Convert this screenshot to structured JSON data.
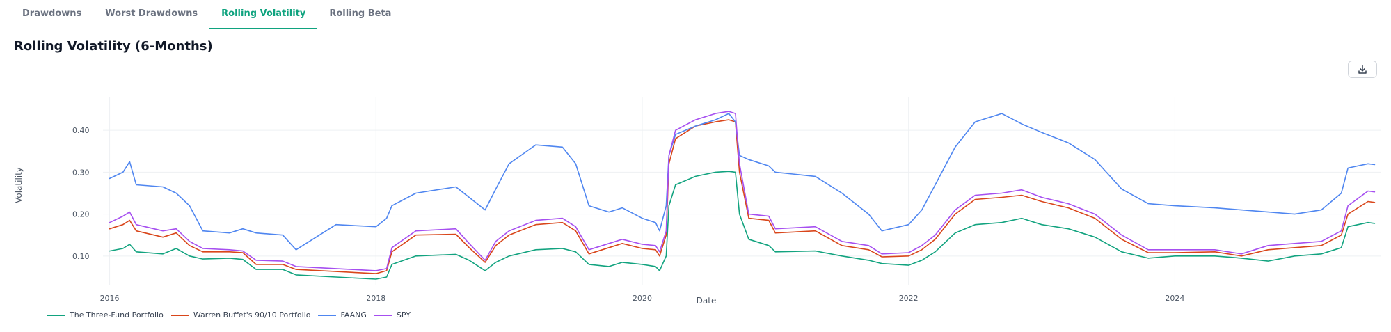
{
  "tabs": [
    {
      "label": "Drawdowns",
      "active": false
    },
    {
      "label": "Worst Drawdowns",
      "active": false
    },
    {
      "label": "Rolling Volatility",
      "active": true
    },
    {
      "label": "Rolling Beta",
      "active": false
    }
  ],
  "chart_title": "Rolling Volatility (6-Months)",
  "download_icon": "download-icon",
  "chart_data": {
    "type": "line",
    "title": "Rolling Volatility (6-Months)",
    "xlabel": "Date",
    "ylabel": "Volatility",
    "x_ticks": [
      "2016",
      "2018",
      "2020",
      "2022",
      "2024"
    ],
    "y_ticks": [
      "0.10",
      "0.20",
      "0.30",
      "0.40"
    ],
    "xlim": [
      2015.95,
      2025.55
    ],
    "ylim": [
      0.03,
      0.47
    ],
    "grid": true,
    "legend_position": "bottom-left",
    "series": [
      {
        "name": "The Three-Fund Portfolio",
        "color": "#12a37f",
        "points": [
          [
            2016.0,
            0.112
          ],
          [
            2016.1,
            0.118
          ],
          [
            2016.15,
            0.128
          ],
          [
            2016.2,
            0.11
          ],
          [
            2016.4,
            0.105
          ],
          [
            2016.5,
            0.118
          ],
          [
            2016.6,
            0.1
          ],
          [
            2016.7,
            0.093
          ],
          [
            2016.9,
            0.095
          ],
          [
            2017.0,
            0.092
          ],
          [
            2017.1,
            0.068
          ],
          [
            2017.3,
            0.068
          ],
          [
            2017.4,
            0.055
          ],
          [
            2017.7,
            0.05
          ],
          [
            2018.0,
            0.045
          ],
          [
            2018.08,
            0.05
          ],
          [
            2018.12,
            0.08
          ],
          [
            2018.3,
            0.1
          ],
          [
            2018.6,
            0.104
          ],
          [
            2018.7,
            0.09
          ],
          [
            2018.82,
            0.065
          ],
          [
            2018.9,
            0.085
          ],
          [
            2019.0,
            0.1
          ],
          [
            2019.2,
            0.115
          ],
          [
            2019.4,
            0.118
          ],
          [
            2019.5,
            0.11
          ],
          [
            2019.6,
            0.08
          ],
          [
            2019.75,
            0.075
          ],
          [
            2019.85,
            0.085
          ],
          [
            2020.0,
            0.08
          ],
          [
            2020.1,
            0.075
          ],
          [
            2020.13,
            0.065
          ],
          [
            2020.18,
            0.1
          ],
          [
            2020.2,
            0.22
          ],
          [
            2020.25,
            0.27
          ],
          [
            2020.4,
            0.29
          ],
          [
            2020.55,
            0.3
          ],
          [
            2020.65,
            0.302
          ],
          [
            2020.7,
            0.3
          ],
          [
            2020.73,
            0.2
          ],
          [
            2020.8,
            0.14
          ],
          [
            2020.95,
            0.125
          ],
          [
            2021.0,
            0.11
          ],
          [
            2021.3,
            0.112
          ],
          [
            2021.5,
            0.1
          ],
          [
            2021.7,
            0.09
          ],
          [
            2021.8,
            0.082
          ],
          [
            2022.0,
            0.078
          ],
          [
            2022.1,
            0.09
          ],
          [
            2022.2,
            0.11
          ],
          [
            2022.35,
            0.155
          ],
          [
            2022.5,
            0.175
          ],
          [
            2022.7,
            0.18
          ],
          [
            2022.85,
            0.19
          ],
          [
            2023.0,
            0.175
          ],
          [
            2023.2,
            0.165
          ],
          [
            2023.4,
            0.145
          ],
          [
            2023.6,
            0.11
          ],
          [
            2023.8,
            0.095
          ],
          [
            2024.0,
            0.1
          ],
          [
            2024.3,
            0.1
          ],
          [
            2024.5,
            0.095
          ],
          [
            2024.7,
            0.088
          ],
          [
            2024.9,
            0.1
          ],
          [
            2025.1,
            0.105
          ],
          [
            2025.25,
            0.12
          ],
          [
            2025.3,
            0.17
          ],
          [
            2025.45,
            0.18
          ],
          [
            2025.5,
            0.178
          ]
        ]
      },
      {
        "name": "Warren Buffet's 90/10 Portfolio",
        "color": "#d9461b",
        "points": [
          [
            2016.0,
            0.165
          ],
          [
            2016.1,
            0.175
          ],
          [
            2016.15,
            0.185
          ],
          [
            2016.2,
            0.16
          ],
          [
            2016.4,
            0.145
          ],
          [
            2016.5,
            0.155
          ],
          [
            2016.6,
            0.125
          ],
          [
            2016.7,
            0.11
          ],
          [
            2016.9,
            0.11
          ],
          [
            2017.0,
            0.108
          ],
          [
            2017.1,
            0.08
          ],
          [
            2017.3,
            0.08
          ],
          [
            2017.4,
            0.068
          ],
          [
            2017.7,
            0.063
          ],
          [
            2018.0,
            0.058
          ],
          [
            2018.08,
            0.065
          ],
          [
            2018.12,
            0.11
          ],
          [
            2018.3,
            0.15
          ],
          [
            2018.6,
            0.152
          ],
          [
            2018.7,
            0.12
          ],
          [
            2018.82,
            0.085
          ],
          [
            2018.9,
            0.125
          ],
          [
            2019.0,
            0.15
          ],
          [
            2019.2,
            0.175
          ],
          [
            2019.4,
            0.18
          ],
          [
            2019.5,
            0.16
          ],
          [
            2019.6,
            0.105
          ],
          [
            2019.75,
            0.12
          ],
          [
            2019.85,
            0.13
          ],
          [
            2020.0,
            0.118
          ],
          [
            2020.1,
            0.115
          ],
          [
            2020.13,
            0.1
          ],
          [
            2020.18,
            0.15
          ],
          [
            2020.2,
            0.32
          ],
          [
            2020.25,
            0.38
          ],
          [
            2020.4,
            0.41
          ],
          [
            2020.55,
            0.42
          ],
          [
            2020.65,
            0.425
          ],
          [
            2020.7,
            0.42
          ],
          [
            2020.73,
            0.3
          ],
          [
            2020.8,
            0.19
          ],
          [
            2020.95,
            0.185
          ],
          [
            2021.0,
            0.155
          ],
          [
            2021.3,
            0.16
          ],
          [
            2021.5,
            0.125
          ],
          [
            2021.7,
            0.115
          ],
          [
            2021.8,
            0.098
          ],
          [
            2022.0,
            0.1
          ],
          [
            2022.1,
            0.115
          ],
          [
            2022.2,
            0.14
          ],
          [
            2022.35,
            0.2
          ],
          [
            2022.5,
            0.235
          ],
          [
            2022.7,
            0.24
          ],
          [
            2022.85,
            0.245
          ],
          [
            2023.0,
            0.23
          ],
          [
            2023.2,
            0.215
          ],
          [
            2023.4,
            0.19
          ],
          [
            2023.6,
            0.14
          ],
          [
            2023.8,
            0.108
          ],
          [
            2024.0,
            0.108
          ],
          [
            2024.3,
            0.11
          ],
          [
            2024.5,
            0.1
          ],
          [
            2024.7,
            0.115
          ],
          [
            2024.9,
            0.12
          ],
          [
            2025.1,
            0.125
          ],
          [
            2025.25,
            0.15
          ],
          [
            2025.3,
            0.2
          ],
          [
            2025.45,
            0.23
          ],
          [
            2025.5,
            0.228
          ]
        ]
      },
      {
        "name": "FAANG",
        "color": "#4f86f0",
        "points": [
          [
            2016.0,
            0.285
          ],
          [
            2016.1,
            0.3
          ],
          [
            2016.15,
            0.325
          ],
          [
            2016.2,
            0.27
          ],
          [
            2016.4,
            0.265
          ],
          [
            2016.5,
            0.25
          ],
          [
            2016.6,
            0.22
          ],
          [
            2016.7,
            0.16
          ],
          [
            2016.9,
            0.155
          ],
          [
            2017.0,
            0.165
          ],
          [
            2017.1,
            0.155
          ],
          [
            2017.3,
            0.15
          ],
          [
            2017.4,
            0.115
          ],
          [
            2017.7,
            0.175
          ],
          [
            2018.0,
            0.17
          ],
          [
            2018.08,
            0.19
          ],
          [
            2018.12,
            0.22
          ],
          [
            2018.3,
            0.25
          ],
          [
            2018.6,
            0.265
          ],
          [
            2018.7,
            0.24
          ],
          [
            2018.82,
            0.21
          ],
          [
            2018.9,
            0.26
          ],
          [
            2019.0,
            0.32
          ],
          [
            2019.2,
            0.365
          ],
          [
            2019.4,
            0.36
          ],
          [
            2019.5,
            0.32
          ],
          [
            2019.6,
            0.22
          ],
          [
            2019.75,
            0.205
          ],
          [
            2019.85,
            0.215
          ],
          [
            2020.0,
            0.19
          ],
          [
            2020.1,
            0.18
          ],
          [
            2020.13,
            0.16
          ],
          [
            2020.18,
            0.22
          ],
          [
            2020.2,
            0.34
          ],
          [
            2020.25,
            0.39
          ],
          [
            2020.4,
            0.41
          ],
          [
            2020.55,
            0.425
          ],
          [
            2020.65,
            0.44
          ],
          [
            2020.7,
            0.42
          ],
          [
            2020.73,
            0.34
          ],
          [
            2020.8,
            0.33
          ],
          [
            2020.95,
            0.315
          ],
          [
            2021.0,
            0.3
          ],
          [
            2021.3,
            0.29
          ],
          [
            2021.5,
            0.25
          ],
          [
            2021.7,
            0.2
          ],
          [
            2021.8,
            0.16
          ],
          [
            2022.0,
            0.175
          ],
          [
            2022.1,
            0.21
          ],
          [
            2022.2,
            0.27
          ],
          [
            2022.35,
            0.36
          ],
          [
            2022.5,
            0.42
          ],
          [
            2022.7,
            0.44
          ],
          [
            2022.85,
            0.415
          ],
          [
            2023.0,
            0.395
          ],
          [
            2023.2,
            0.37
          ],
          [
            2023.4,
            0.33
          ],
          [
            2023.6,
            0.26
          ],
          [
            2023.8,
            0.225
          ],
          [
            2024.0,
            0.22
          ],
          [
            2024.3,
            0.215
          ],
          [
            2024.5,
            0.21
          ],
          [
            2024.7,
            0.205
          ],
          [
            2024.9,
            0.2
          ],
          [
            2025.1,
            0.21
          ],
          [
            2025.25,
            0.25
          ],
          [
            2025.3,
            0.31
          ],
          [
            2025.45,
            0.32
          ],
          [
            2025.5,
            0.318
          ]
        ]
      },
      {
        "name": "SPY",
        "color": "#a64ff0",
        "points": [
          [
            2016.0,
            0.18
          ],
          [
            2016.1,
            0.195
          ],
          [
            2016.15,
            0.205
          ],
          [
            2016.2,
            0.175
          ],
          [
            2016.4,
            0.16
          ],
          [
            2016.5,
            0.165
          ],
          [
            2016.6,
            0.135
          ],
          [
            2016.7,
            0.118
          ],
          [
            2016.9,
            0.115
          ],
          [
            2017.0,
            0.112
          ],
          [
            2017.1,
            0.09
          ],
          [
            2017.3,
            0.088
          ],
          [
            2017.4,
            0.075
          ],
          [
            2017.7,
            0.07
          ],
          [
            2018.0,
            0.065
          ],
          [
            2018.08,
            0.07
          ],
          [
            2018.12,
            0.12
          ],
          [
            2018.3,
            0.16
          ],
          [
            2018.6,
            0.165
          ],
          [
            2018.7,
            0.13
          ],
          [
            2018.82,
            0.09
          ],
          [
            2018.9,
            0.135
          ],
          [
            2019.0,
            0.16
          ],
          [
            2019.2,
            0.185
          ],
          [
            2019.4,
            0.19
          ],
          [
            2019.5,
            0.17
          ],
          [
            2019.6,
            0.115
          ],
          [
            2019.75,
            0.13
          ],
          [
            2019.85,
            0.14
          ],
          [
            2020.0,
            0.128
          ],
          [
            2020.1,
            0.125
          ],
          [
            2020.13,
            0.11
          ],
          [
            2020.18,
            0.16
          ],
          [
            2020.2,
            0.34
          ],
          [
            2020.25,
            0.4
          ],
          [
            2020.4,
            0.425
          ],
          [
            2020.55,
            0.44
          ],
          [
            2020.65,
            0.445
          ],
          [
            2020.7,
            0.44
          ],
          [
            2020.73,
            0.32
          ],
          [
            2020.8,
            0.2
          ],
          [
            2020.95,
            0.195
          ],
          [
            2021.0,
            0.165
          ],
          [
            2021.3,
            0.17
          ],
          [
            2021.5,
            0.135
          ],
          [
            2021.7,
            0.125
          ],
          [
            2021.8,
            0.105
          ],
          [
            2022.0,
            0.108
          ],
          [
            2022.1,
            0.125
          ],
          [
            2022.2,
            0.15
          ],
          [
            2022.35,
            0.21
          ],
          [
            2022.5,
            0.245
          ],
          [
            2022.7,
            0.25
          ],
          [
            2022.85,
            0.258
          ],
          [
            2023.0,
            0.24
          ],
          [
            2023.2,
            0.225
          ],
          [
            2023.4,
            0.2
          ],
          [
            2023.6,
            0.15
          ],
          [
            2023.8,
            0.115
          ],
          [
            2024.0,
            0.115
          ],
          [
            2024.3,
            0.115
          ],
          [
            2024.5,
            0.105
          ],
          [
            2024.7,
            0.125
          ],
          [
            2024.9,
            0.13
          ],
          [
            2025.1,
            0.135
          ],
          [
            2025.25,
            0.16
          ],
          [
            2025.3,
            0.22
          ],
          [
            2025.45,
            0.255
          ],
          [
            2025.5,
            0.253
          ]
        ]
      }
    ]
  }
}
